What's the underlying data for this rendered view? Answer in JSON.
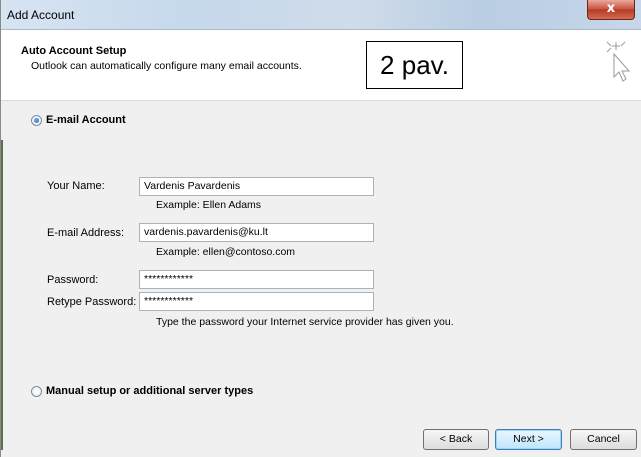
{
  "window": {
    "title": "Add Account",
    "close_glyph": "x"
  },
  "header": {
    "title": "Auto Account Setup",
    "subtitle": "Outlook can automatically configure many email accounts.",
    "stamp_text": "2 pav.",
    "icon": "cursor-sparkle-icon"
  },
  "options": {
    "email_account_label": "E-mail Account",
    "email_account_selected": true,
    "manual_setup_label": "Manual setup or additional server types",
    "manual_setup_selected": false
  },
  "form": {
    "name_label": "Your Name:",
    "name_value": "Vardenis Pavardenis",
    "name_hint": "Example: Ellen Adams",
    "email_label": "E-mail Address:",
    "email_value": "vardenis.pavardenis@ku.lt",
    "email_hint": "Example: ellen@contoso.com",
    "password_label": "Password:",
    "password_value": "************",
    "retype_label": "Retype Password:",
    "retype_value": "************",
    "password_hint": "Type the password your Internet service provider has given you."
  },
  "buttons": {
    "back": "< Back",
    "next": "Next >",
    "cancel": "Cancel"
  }
}
